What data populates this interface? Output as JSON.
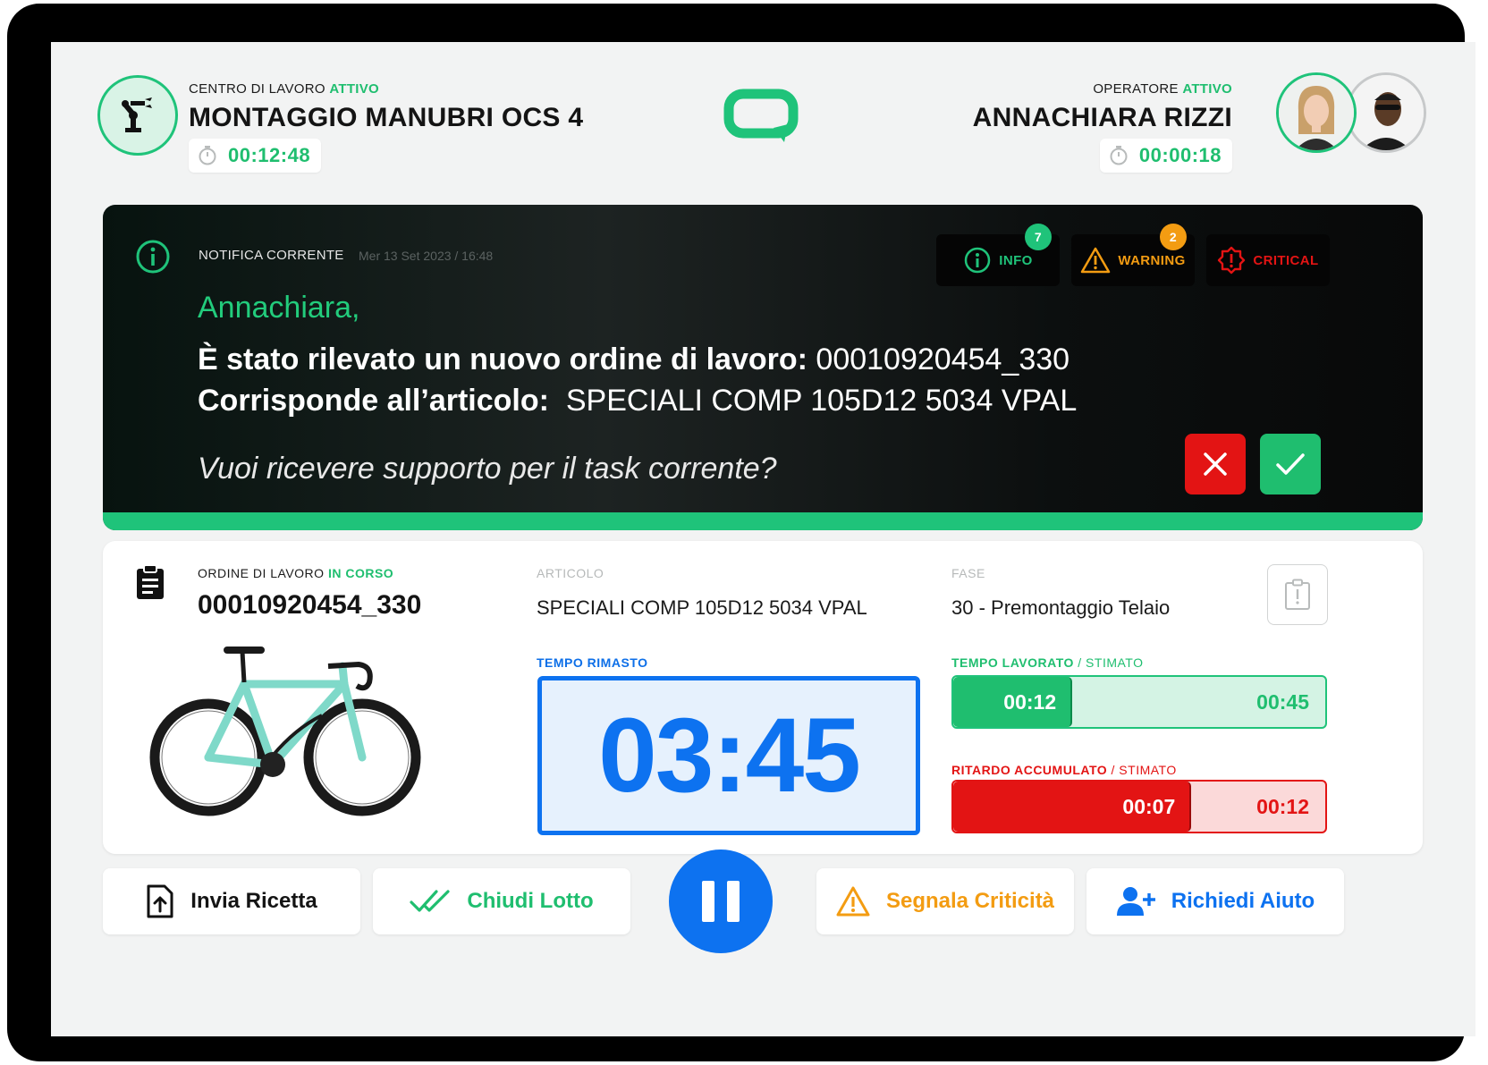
{
  "workcenter": {
    "label": "CENTRO DI LAVORO",
    "status": "ATTIVO",
    "name": "MONTAGGIO MANUBRI OCS 4",
    "timer": "00:12:48"
  },
  "operator": {
    "label": "OPERATORE",
    "status": "ATTIVO",
    "name": "ANNACHIARA RIZZI",
    "timer": "00:00:18"
  },
  "notification": {
    "label": "NOTIFICA CORRENTE",
    "date": "Mer 13 Set 2023 / 16:48",
    "greeting": "Annachiara,",
    "line1_label": "È stato rilevato un nuovo ordine di lavoro:",
    "line1_value": "00010920454_330",
    "line2_label": "Corrisponde all’articolo:",
    "line2_value": "SPECIALI COMP 105D12 5034 VPAL",
    "question": "Vuoi ricevere supporto per il task corrente?",
    "filters": [
      {
        "label": "INFO",
        "count": "7",
        "color": "#1fc37a"
      },
      {
        "label": "WARNING",
        "count": "2",
        "color": "#f39c12"
      },
      {
        "label": "CRITICAL",
        "count": "",
        "color": "#e31414"
      }
    ],
    "colors": {
      "accent": "#1fc37a",
      "reject": "#e31414",
      "accept": "#1fbe6f"
    }
  },
  "work_order": {
    "label": "ORDINE DI LAVORO",
    "status": "IN CORSO",
    "number": "00010920454_330",
    "article_label": "ARTICOLO",
    "article": "SPECIALI COMP 105D12 5034 VPAL",
    "phase_label": "FASE",
    "phase": "30 - Premontaggio Telaio",
    "remaining_label": "TEMPO RIMASTO",
    "remaining": "03:45",
    "worked_label": "TEMPO LAVORATO",
    "worked_suffix": "/ STIMATO",
    "worked": "00:12",
    "worked_estimated": "00:45",
    "worked_fraction": 0.32,
    "delay_label": "RITARDO ACCUMULATO",
    "delay_suffix": "/ STIMATO",
    "delay": "00:07",
    "delay_estimated": "00:12",
    "delay_fraction": 0.64
  },
  "actions": {
    "send_recipe": "Invia Ricetta",
    "close_batch": "Chiudi Lotto",
    "report_issue": "Segnala Criticità",
    "request_help": "Richiedi Aiuto"
  }
}
